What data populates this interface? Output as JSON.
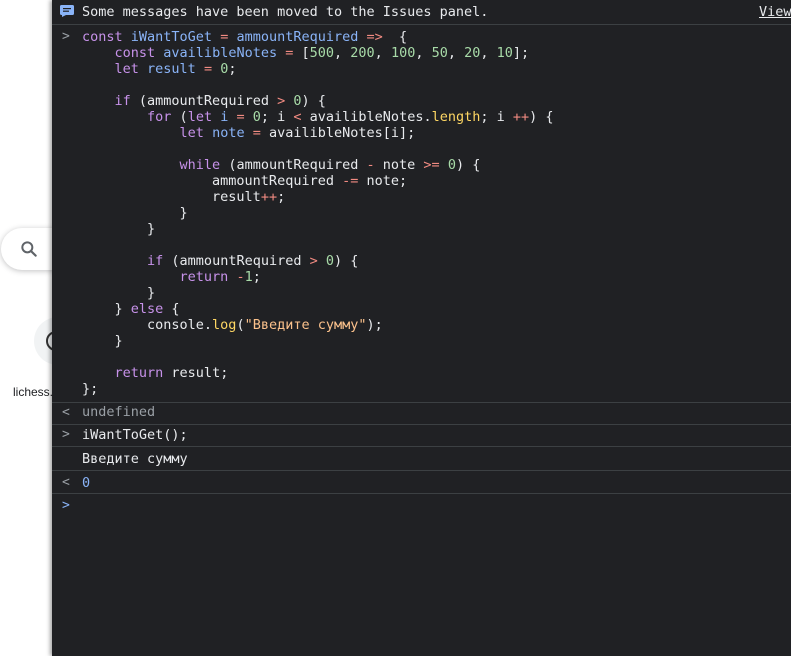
{
  "background": {
    "shortcut_label": "lichess."
  },
  "console": {
    "info_message": "Some messages have been moved to the Issues panel.",
    "info_link": "View",
    "input_prompt": ">",
    "output_prompt": "<",
    "code_lines": [
      [
        [
          "kw",
          "const "
        ],
        [
          "fn",
          "iWantToGet"
        ],
        [
          "op",
          " = "
        ],
        [
          "vr",
          "ammountRequired"
        ],
        [
          "op",
          " =>"
        ],
        [
          "",
          "  {"
        ]
      ],
      [
        [
          "",
          "    "
        ],
        [
          "kw",
          "const "
        ],
        [
          "vr",
          "availibleNotes"
        ],
        [
          "op",
          " = "
        ],
        [
          "",
          "["
        ],
        [
          "num",
          "500"
        ],
        [
          "",
          ", "
        ],
        [
          "num",
          "200"
        ],
        [
          "",
          ", "
        ],
        [
          "num",
          "100"
        ],
        [
          "",
          ", "
        ],
        [
          "num",
          "50"
        ],
        [
          "",
          ", "
        ],
        [
          "num",
          "20"
        ],
        [
          "",
          ", "
        ],
        [
          "num",
          "10"
        ],
        [
          "",
          "];"
        ]
      ],
      [
        [
          "",
          "    "
        ],
        [
          "kw",
          "let "
        ],
        [
          "vr",
          "result"
        ],
        [
          "op",
          " = "
        ],
        [
          "num",
          "0"
        ],
        [
          "",
          ";"
        ]
      ],
      [
        [
          "",
          ""
        ]
      ],
      [
        [
          "",
          "    "
        ],
        [
          "kw",
          "if"
        ],
        [
          "",
          " (ammountRequired "
        ],
        [
          "op",
          ">"
        ],
        [
          "",
          "",
          " "
        ],
        [
          "num",
          "0"
        ],
        [
          "",
          ") {"
        ]
      ],
      [
        [
          "",
          "        "
        ],
        [
          "kw",
          "for"
        ],
        [
          "",
          " ("
        ],
        [
          "kw",
          "let "
        ],
        [
          "vr",
          "i"
        ],
        [
          "op",
          " = "
        ],
        [
          "num",
          "0"
        ],
        [
          "",
          "; i "
        ],
        [
          "op",
          "<"
        ],
        [
          "",
          " availibleNotes."
        ],
        [
          "prop",
          "length"
        ],
        [
          "",
          "; i "
        ],
        [
          "op",
          "++"
        ],
        [
          "",
          ") {"
        ]
      ],
      [
        [
          "",
          "            "
        ],
        [
          "kw",
          "let "
        ],
        [
          "vr",
          "note"
        ],
        [
          "op",
          " = "
        ],
        [
          "",
          "availibleNotes[i];"
        ]
      ],
      [
        [
          "",
          ""
        ]
      ],
      [
        [
          "",
          "            "
        ],
        [
          "kw",
          "while"
        ],
        [
          "",
          " (ammountRequired "
        ],
        [
          "op",
          "-"
        ],
        [
          "",
          " note "
        ],
        [
          "op",
          ">="
        ],
        [
          "",
          "",
          " "
        ],
        [
          "num",
          "0"
        ],
        [
          "",
          ") {"
        ]
      ],
      [
        [
          "",
          "                ammountRequired "
        ],
        [
          "op",
          "-="
        ],
        [
          "",
          " note;"
        ]
      ],
      [
        [
          "",
          "                result"
        ],
        [
          "op",
          "++"
        ],
        [
          "",
          ";"
        ]
      ],
      [
        [
          "",
          "            }"
        ]
      ],
      [
        [
          "",
          "        }"
        ]
      ],
      [
        [
          "",
          ""
        ]
      ],
      [
        [
          "",
          "        "
        ],
        [
          "kw",
          "if"
        ],
        [
          "",
          " (ammountRequired "
        ],
        [
          "op",
          ">"
        ],
        [
          "",
          "",
          " "
        ],
        [
          "num",
          "0"
        ],
        [
          "",
          ") {"
        ]
      ],
      [
        [
          "",
          "            "
        ],
        [
          "kw",
          "return "
        ],
        [
          "op",
          "-"
        ],
        [
          "num",
          "1"
        ],
        [
          "",
          ";"
        ]
      ],
      [
        [
          "",
          "        }"
        ]
      ],
      [
        [
          "",
          "    } "
        ],
        [
          "kw",
          "else"
        ],
        [
          "",
          " {"
        ]
      ],
      [
        [
          "",
          "        console."
        ],
        [
          "prop",
          "log"
        ],
        [
          "",
          "("
        ],
        [
          "str",
          "\"Введите сумму\""
        ],
        [
          "",
          ");"
        ]
      ],
      [
        [
          "",
          "    }"
        ]
      ],
      [
        [
          "",
          ""
        ]
      ],
      [
        [
          "",
          "    "
        ],
        [
          "kw",
          "return"
        ],
        [
          "",
          " result;"
        ]
      ],
      [
        [
          "",
          "};"
        ]
      ]
    ],
    "result_1": "undefined",
    "input_2": "iWantToGet();",
    "log_output": "Введите сумму",
    "result_2": "0"
  }
}
